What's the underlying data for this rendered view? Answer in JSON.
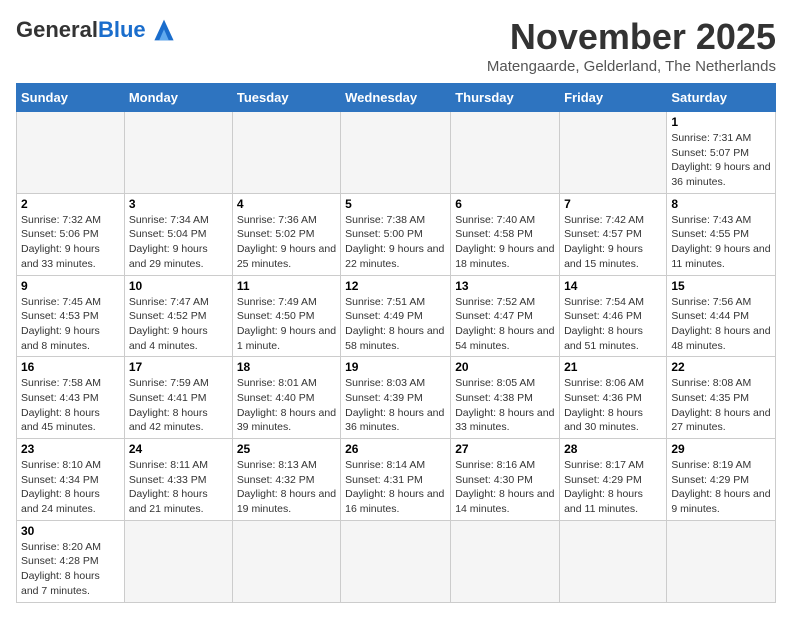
{
  "logo": {
    "general": "General",
    "blue": "Blue"
  },
  "title": "November 2025",
  "subtitle": "Matengaarde, Gelderland, The Netherlands",
  "days_of_week": [
    "Sunday",
    "Monday",
    "Tuesday",
    "Wednesday",
    "Thursday",
    "Friday",
    "Saturday"
  ],
  "weeks": [
    [
      {
        "day": "",
        "info": ""
      },
      {
        "day": "",
        "info": ""
      },
      {
        "day": "",
        "info": ""
      },
      {
        "day": "",
        "info": ""
      },
      {
        "day": "",
        "info": ""
      },
      {
        "day": "",
        "info": ""
      },
      {
        "day": "1",
        "info": "Sunrise: 7:31 AM\nSunset: 5:07 PM\nDaylight: 9 hours and 36 minutes."
      }
    ],
    [
      {
        "day": "2",
        "info": "Sunrise: 7:32 AM\nSunset: 5:06 PM\nDaylight: 9 hours and 33 minutes."
      },
      {
        "day": "3",
        "info": "Sunrise: 7:34 AM\nSunset: 5:04 PM\nDaylight: 9 hours and 29 minutes."
      },
      {
        "day": "4",
        "info": "Sunrise: 7:36 AM\nSunset: 5:02 PM\nDaylight: 9 hours and 25 minutes."
      },
      {
        "day": "5",
        "info": "Sunrise: 7:38 AM\nSunset: 5:00 PM\nDaylight: 9 hours and 22 minutes."
      },
      {
        "day": "6",
        "info": "Sunrise: 7:40 AM\nSunset: 4:58 PM\nDaylight: 9 hours and 18 minutes."
      },
      {
        "day": "7",
        "info": "Sunrise: 7:42 AM\nSunset: 4:57 PM\nDaylight: 9 hours and 15 minutes."
      },
      {
        "day": "8",
        "info": "Sunrise: 7:43 AM\nSunset: 4:55 PM\nDaylight: 9 hours and 11 minutes."
      }
    ],
    [
      {
        "day": "9",
        "info": "Sunrise: 7:45 AM\nSunset: 4:53 PM\nDaylight: 9 hours and 8 minutes."
      },
      {
        "day": "10",
        "info": "Sunrise: 7:47 AM\nSunset: 4:52 PM\nDaylight: 9 hours and 4 minutes."
      },
      {
        "day": "11",
        "info": "Sunrise: 7:49 AM\nSunset: 4:50 PM\nDaylight: 9 hours and 1 minute."
      },
      {
        "day": "12",
        "info": "Sunrise: 7:51 AM\nSunset: 4:49 PM\nDaylight: 8 hours and 58 minutes."
      },
      {
        "day": "13",
        "info": "Sunrise: 7:52 AM\nSunset: 4:47 PM\nDaylight: 8 hours and 54 minutes."
      },
      {
        "day": "14",
        "info": "Sunrise: 7:54 AM\nSunset: 4:46 PM\nDaylight: 8 hours and 51 minutes."
      },
      {
        "day": "15",
        "info": "Sunrise: 7:56 AM\nSunset: 4:44 PM\nDaylight: 8 hours and 48 minutes."
      }
    ],
    [
      {
        "day": "16",
        "info": "Sunrise: 7:58 AM\nSunset: 4:43 PM\nDaylight: 8 hours and 45 minutes."
      },
      {
        "day": "17",
        "info": "Sunrise: 7:59 AM\nSunset: 4:41 PM\nDaylight: 8 hours and 42 minutes."
      },
      {
        "day": "18",
        "info": "Sunrise: 8:01 AM\nSunset: 4:40 PM\nDaylight: 8 hours and 39 minutes."
      },
      {
        "day": "19",
        "info": "Sunrise: 8:03 AM\nSunset: 4:39 PM\nDaylight: 8 hours and 36 minutes."
      },
      {
        "day": "20",
        "info": "Sunrise: 8:05 AM\nSunset: 4:38 PM\nDaylight: 8 hours and 33 minutes."
      },
      {
        "day": "21",
        "info": "Sunrise: 8:06 AM\nSunset: 4:36 PM\nDaylight: 8 hours and 30 minutes."
      },
      {
        "day": "22",
        "info": "Sunrise: 8:08 AM\nSunset: 4:35 PM\nDaylight: 8 hours and 27 minutes."
      }
    ],
    [
      {
        "day": "23",
        "info": "Sunrise: 8:10 AM\nSunset: 4:34 PM\nDaylight: 8 hours and 24 minutes."
      },
      {
        "day": "24",
        "info": "Sunrise: 8:11 AM\nSunset: 4:33 PM\nDaylight: 8 hours and 21 minutes."
      },
      {
        "day": "25",
        "info": "Sunrise: 8:13 AM\nSunset: 4:32 PM\nDaylight: 8 hours and 19 minutes."
      },
      {
        "day": "26",
        "info": "Sunrise: 8:14 AM\nSunset: 4:31 PM\nDaylight: 8 hours and 16 minutes."
      },
      {
        "day": "27",
        "info": "Sunrise: 8:16 AM\nSunset: 4:30 PM\nDaylight: 8 hours and 14 minutes."
      },
      {
        "day": "28",
        "info": "Sunrise: 8:17 AM\nSunset: 4:29 PM\nDaylight: 8 hours and 11 minutes."
      },
      {
        "day": "29",
        "info": "Sunrise: 8:19 AM\nSunset: 4:29 PM\nDaylight: 8 hours and 9 minutes."
      }
    ],
    [
      {
        "day": "30",
        "info": "Sunrise: 8:20 AM\nSunset: 4:28 PM\nDaylight: 8 hours and 7 minutes."
      },
      {
        "day": "",
        "info": ""
      },
      {
        "day": "",
        "info": ""
      },
      {
        "day": "",
        "info": ""
      },
      {
        "day": "",
        "info": ""
      },
      {
        "day": "",
        "info": ""
      },
      {
        "day": "",
        "info": ""
      }
    ]
  ]
}
